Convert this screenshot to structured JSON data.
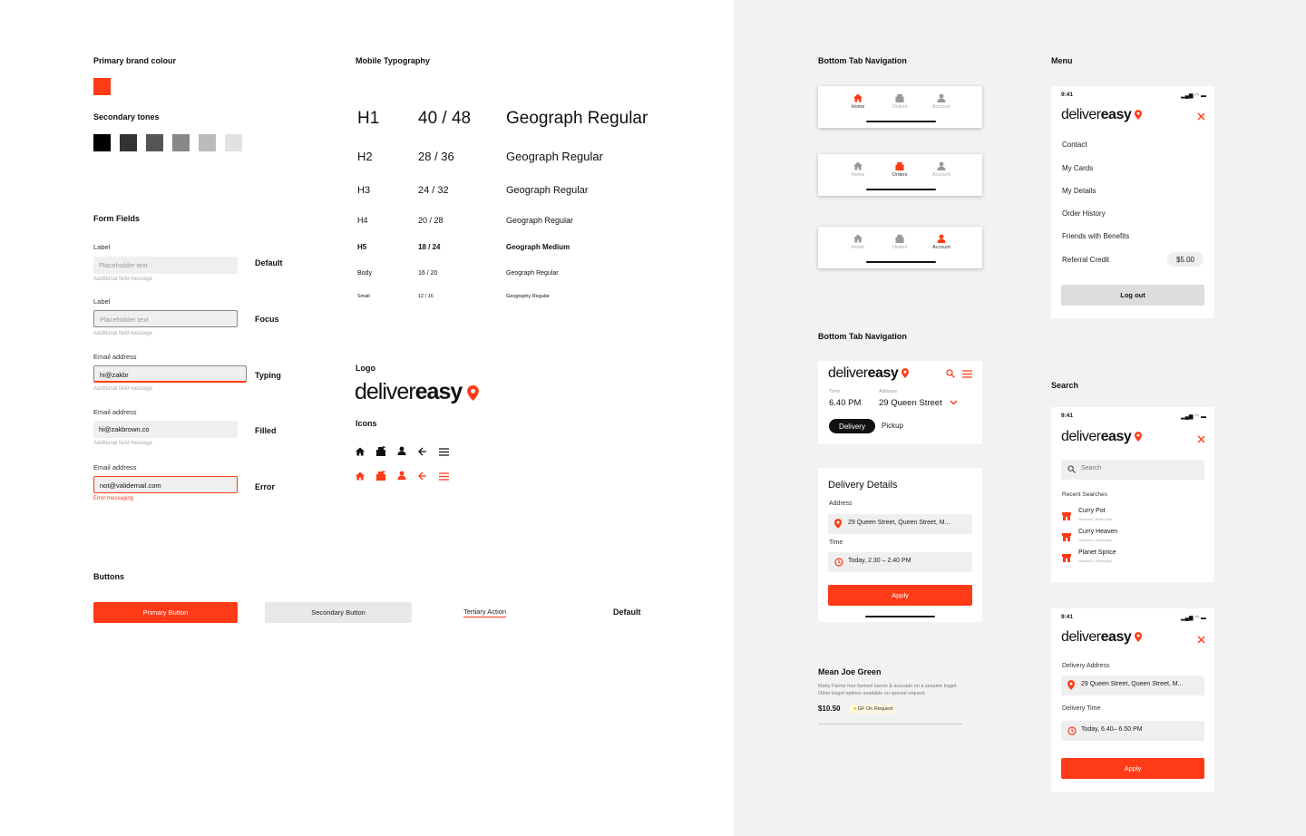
{
  "colors": {
    "brand": "#ff3a16",
    "tones": [
      "#000000",
      "#333333",
      "#555555",
      "#888888",
      "#bbbbbb",
      "#e2e2e2"
    ]
  },
  "left": {
    "brand_heading": "Primary brand colour",
    "secondary_heading": "Secondary tones",
    "form_heading": "Form Fields",
    "fields": [
      {
        "label": "Label",
        "value": "Placeholder text",
        "message": "Additional field message",
        "state": "Default"
      },
      {
        "label": "Label",
        "value": "Placeholder text",
        "message": "Additional field message",
        "state": "Focus"
      },
      {
        "label": "Email address",
        "value": "hi@zakbr",
        "message": "Additional field message",
        "state": "Typing"
      },
      {
        "label": "Email address",
        "value": "hi@zakbrown.co",
        "message": "Additional field message",
        "state": "Filled"
      },
      {
        "label": "Email address",
        "value": "not@validemail.com",
        "message": "Error messaging",
        "state": "Error"
      }
    ],
    "buttons_heading": "Buttons",
    "primary_button": "Primary Button",
    "secondary_button": "Secondary Button",
    "tertiary_action": "Tertiary Action",
    "buttons_state": "Default"
  },
  "typography": {
    "heading": "Mobile Typography",
    "rows": [
      {
        "name": "H1",
        "size": "40 / 48",
        "font": "Geograph Regular"
      },
      {
        "name": "H2",
        "size": "28 / 36",
        "font": "Geograph Regular"
      },
      {
        "name": "H3",
        "size": "24 / 32",
        "font": "Geograph Regular"
      },
      {
        "name": "H4",
        "size": "20 / 28",
        "font": "Geograph Regular"
      },
      {
        "name": "H5",
        "size": "18 / 24",
        "font": "Geograph Medium"
      },
      {
        "name": "Body",
        "size": "16 / 20",
        "font": "Geograph Regular"
      },
      {
        "name": "Small",
        "size": "12 / 16",
        "font": "Geography Regular"
      }
    ],
    "logo_heading": "Logo",
    "icons_heading": "Icons"
  },
  "logo": {
    "part1": "deliver",
    "part2": "easy"
  },
  "tabnav": {
    "heading": "Bottom Tab Navigation",
    "tabs": [
      "Home",
      "Orders",
      "Account"
    ]
  },
  "tabnav2": {
    "heading": "Bottom Tab Navigation",
    "time_label": "Time",
    "time_value": "6.40 PM",
    "address_label": "Address",
    "address_value": "29 Queen Street",
    "toggle_on": "Delivery",
    "toggle_off": "Pickup"
  },
  "delivery_details": {
    "title": "Delivery Details",
    "address_label": "Address",
    "address_value": "29 Queen Street, Queen Street, M...",
    "time_label": "Time",
    "time_value": "Today, 2.30 – 2.40 PM",
    "apply": "Apply"
  },
  "product": {
    "name": "Mean Joe Green",
    "description": "Mahy Farms free farmed bacon & avocado on a sesame bagel. Other bagel options available on special request.",
    "price": "$10.50",
    "tag": "GF On Request"
  },
  "menu": {
    "heading": "Menu",
    "time": "9:41",
    "items": [
      "Contact",
      "My Cards",
      "My Details",
      "Order History",
      "Friends with Benefits",
      "Referral Credit"
    ],
    "credit": "$5.00",
    "logout": "Log out"
  },
  "search": {
    "heading": "Search",
    "time": "9:41",
    "placeholder": "Search",
    "recent_label": "Recent Searches",
    "results": [
      {
        "name": "Curry Pot",
        "location": "Newtown, Wellington"
      },
      {
        "name": "Curry Heaven",
        "location": "Newtown, Wellington"
      },
      {
        "name": "Planet Sprice",
        "location": "Newtown, Wellington"
      }
    ]
  },
  "delivery_panel": {
    "time": "9:41",
    "address_label": "Delivery Address",
    "address_value": "29 Queen Street, Queen Street, M...",
    "time_label": "Delivery Time",
    "time_value": "Today, 6.40– 6.50 PM",
    "apply": "Apply"
  }
}
